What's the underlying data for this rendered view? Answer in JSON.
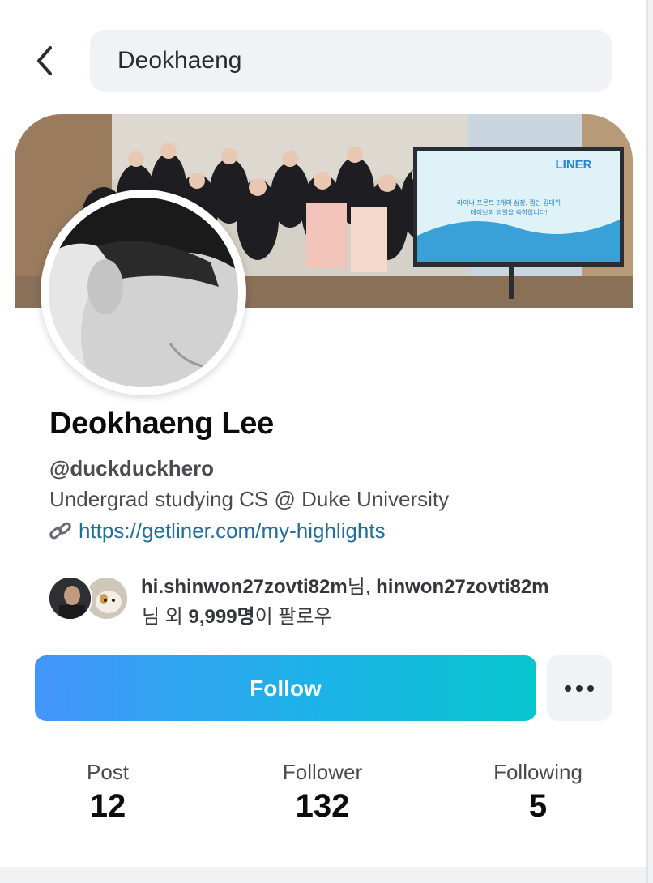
{
  "header": {
    "back_icon": "chevron-left-icon",
    "search_value": "Deokhaeng"
  },
  "cover": {
    "screen_brand": "LINER",
    "screen_message_line1": "라이너 프론트 2개의 심장, 캡틴 김대위",
    "screen_message_line2": "데이브의 생일을 축하합니다!"
  },
  "profile": {
    "name": "Deokhaeng Lee",
    "handle": "@duckduckhero",
    "bio": "Undergrad studying CS @ Duke University",
    "link_icon": "link-icon",
    "link": "https://getliner.com/my-highlights"
  },
  "followed_by": {
    "user1": "hi.shinwon27zovti82m",
    "suffix1": "님, ",
    "user2": "hinwon27zovti82m",
    "prefix2": "님 외 ",
    "count": "9,999명",
    "suffix2": "이 팔로우"
  },
  "actions": {
    "follow_label": "Follow",
    "more_icon": "more-horizontal-icon"
  },
  "stats": [
    {
      "label": "Post",
      "value": "12"
    },
    {
      "label": "Follower",
      "value": "132"
    },
    {
      "label": "Following",
      "value": "5"
    }
  ],
  "colors": {
    "follow_gradient_start": "#4495fb",
    "follow_gradient_end": "#08c6cf",
    "link": "#1f6f9a"
  }
}
